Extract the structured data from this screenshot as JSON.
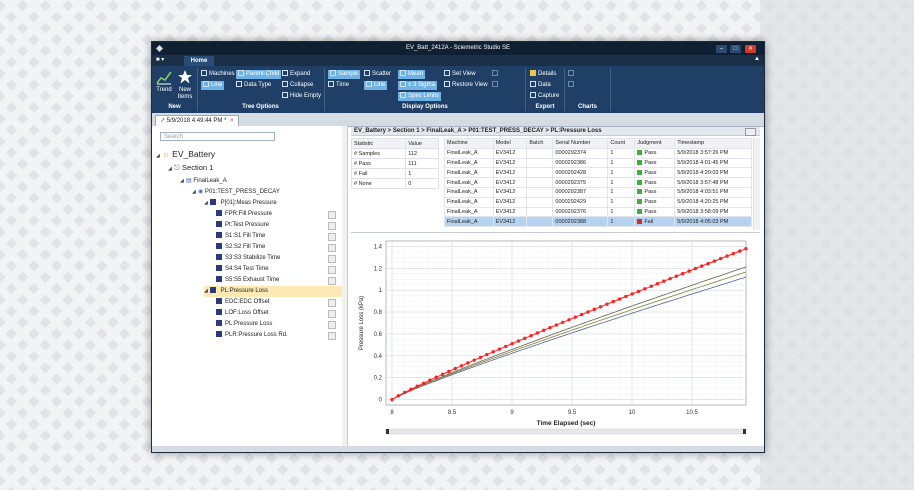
{
  "window": {
    "title": "EV_Batt_2412A - Sciemetric Studio SE"
  },
  "menu": {
    "file_label": "■ ▾",
    "home_tab": "Home"
  },
  "ribbon": {
    "new_group": {
      "trend": "Trend",
      "new_items": "New Items",
      "label": "New"
    },
    "tree_options": {
      "machines": "Machines",
      "parent_child": "Parent-Child",
      "expand": "Expand",
      "line": "Line",
      "data_type": "Data Type",
      "collapse": "Collapse",
      "hide_empty": "Hide Empty",
      "label": "Tree Options"
    },
    "display_options": {
      "sample": "Sample",
      "time": "Time",
      "scatter": "Scatter",
      "line": "Line",
      "mean": "Mean",
      "sigma": "± 3 Sigma",
      "spec_limits": "Spec Limits",
      "set_view": "Set View",
      "restore_view": "Restore View",
      "label": "Display Options"
    },
    "export": {
      "details": "Details",
      "data": "Data",
      "capture": "Capture",
      "label": "Export"
    },
    "charts": {
      "label": "Charts"
    }
  },
  "doc_tab": {
    "label": "5/9/2018 4:49:44 PM *"
  },
  "search": {
    "placeholder": "Search"
  },
  "tree": {
    "root": "EV_Battery",
    "section": "Section 1",
    "station": "FinalLeak_A",
    "test": "P01:TEST_PRESS_DECAY",
    "group1": "P[01]:Meas Pressure",
    "group1_items": [
      "FPR:Fill Pressure",
      "Pt:Test Pressure",
      "S1:S1 Fill Time",
      "S2:S2 Fill Time",
      "S3:S3 Stabilize Time",
      "S4:S4 Test Time",
      "S5:S5 Exhaust Time"
    ],
    "group2": "PL:Pressure Loss",
    "group2_items": [
      "EDC:EDC Offset",
      "LOF:Loss Offset",
      "PL:Pressure Loss",
      "PLR:Pressure Loss Rd."
    ]
  },
  "breadcrumb": "EV_Battery > Section 1 > FinalLeak_A > P01:TEST_PRESS_DECAY > PL:Pressure Loss",
  "stats": {
    "headers": [
      "Statistic",
      "Value"
    ],
    "rows": [
      [
        "# Samples",
        "112"
      ],
      [
        "# Pass",
        "111"
      ],
      [
        "# Fail",
        "1"
      ],
      [
        "# None",
        "0"
      ]
    ]
  },
  "records": {
    "headers": [
      "Machine",
      "Model",
      "Batch",
      "Serial Number",
      "Count",
      "Judgment",
      "Timestamp"
    ],
    "rows": [
      [
        "FinalLeak_A",
        "EV3412",
        "",
        "0000292374",
        "1",
        "Pass",
        "5/9/2018 3:57:26 PM"
      ],
      [
        "FinalLeak_A",
        "EV3412",
        "",
        "0000292386",
        "1",
        "Pass",
        "5/9/2018 4:01:45 PM"
      ],
      [
        "FinalLeak_A",
        "EV3412",
        "",
        "0000292428",
        "1",
        "Pass",
        "5/9/2018 4:20:03 PM"
      ],
      [
        "FinalLeak_A",
        "EV3412",
        "",
        "0000292375",
        "1",
        "Pass",
        "5/9/2018 3:57:48 PM"
      ],
      [
        "FinalLeak_A",
        "EV3412",
        "",
        "0000292387",
        "1",
        "Pass",
        "5/9/2018 4:03:51 PM"
      ],
      [
        "FinalLeak_A",
        "EV3412",
        "",
        "0000292429",
        "1",
        "Pass",
        "5/9/2018 4:20:25 PM"
      ],
      [
        "FinalLeak_A",
        "EV3412",
        "",
        "0000292376",
        "1",
        "Pass",
        "5/9/2018 3:58:09 PM"
      ],
      [
        "FinalLeak_A",
        "EV3412",
        "",
        "0000292388",
        "1",
        "Fail",
        "5/9/2018 4:05:03 PM"
      ]
    ]
  },
  "colors": {
    "accent": "#1f3f66",
    "highlight_series": "#ff2020",
    "pass": "#3fae3f",
    "fail": "#d52b2b"
  },
  "chart_data": {
    "type": "line",
    "xlabel": "Time Elapsed (sec)",
    "ylabel": "Pressure Loss (kPa)",
    "xlim": [
      7.95,
      10.95
    ],
    "ylim": [
      -0.05,
      1.45
    ],
    "xticks": [
      "8",
      "8.5",
      "9",
      "9.5",
      "10",
      "10.5"
    ],
    "yticks": [
      "0",
      "0.2",
      "0.4",
      "0.6",
      "0.8",
      "1",
      "1.2",
      "1.4"
    ],
    "grid": true,
    "highlight": {
      "name": "",
      "color": "#ff2020",
      "x_start": 8,
      "x_end": 10.95,
      "y_start": 0,
      "y_end": 1.38
    },
    "bundle": {
      "count": 111,
      "y_end_min": 1.12,
      "y_end_max": 1.26
    }
  }
}
